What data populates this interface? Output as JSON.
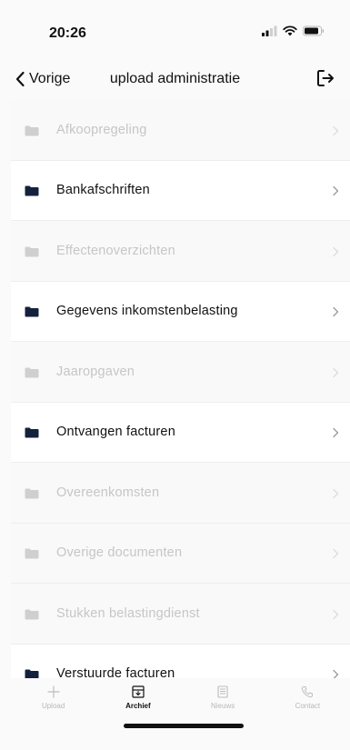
{
  "status": {
    "time": "20:26"
  },
  "nav": {
    "back_label": "Vorige",
    "title": "upload administratie"
  },
  "folders": [
    {
      "label": "Afkoopregeling",
      "enabled": false
    },
    {
      "label": "Bankafschriften",
      "enabled": true
    },
    {
      "label": "Effectenoverzichten",
      "enabled": false
    },
    {
      "label": "Gegevens inkomstenbelasting",
      "enabled": true
    },
    {
      "label": "Jaaropgaven",
      "enabled": false
    },
    {
      "label": "Ontvangen facturen",
      "enabled": true
    },
    {
      "label": "Overeenkomsten",
      "enabled": false
    },
    {
      "label": "Overige documenten",
      "enabled": false
    },
    {
      "label": "Stukken belastingdienst",
      "enabled": false
    },
    {
      "label": "Verstuurde facturen",
      "enabled": true
    }
  ],
  "tabs": [
    {
      "label": "Upload",
      "icon": "plus-icon",
      "active": false
    },
    {
      "label": "Archief",
      "icon": "archive-icon",
      "active": true
    },
    {
      "label": "Nieuws",
      "icon": "news-icon",
      "active": false
    },
    {
      "label": "Contact",
      "icon": "phone-icon",
      "active": false
    }
  ],
  "colors": {
    "folder_active": "#14213d",
    "folder_disabled": "#cfcfcf",
    "text_disabled": "#c6c6c6"
  }
}
